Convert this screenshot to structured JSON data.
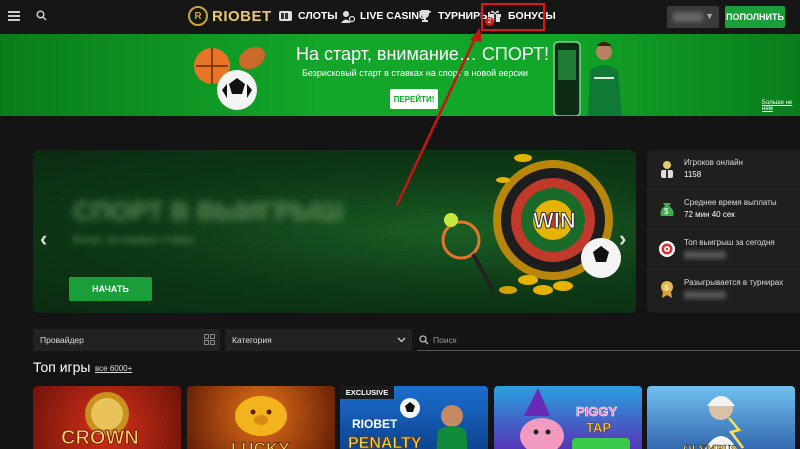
{
  "header": {
    "brand": "RIOBET",
    "nav": [
      {
        "label": "СЛОТЫ",
        "icon": "slots-icon"
      },
      {
        "label": "LIVE CASINO",
        "icon": "live-dealer-icon"
      },
      {
        "label": "ТУРНИРЫ",
        "icon": "trophy-icon"
      },
      {
        "label": "БОНУСЫ",
        "icon": "gift-icon"
      }
    ],
    "bonus_badge": "2",
    "topup_label": "ПОПОЛНИТЬ"
  },
  "promo": {
    "title": "На старт, внимание… СПОРТ!",
    "subtitle": "Безрисковый старт в ставках на спорт в новой версии",
    "button": "ПЕРЕЙТИ!",
    "more_link": "Больше не нем"
  },
  "hero": {
    "title": "СПОРТ В ВЫИГРЫШ",
    "subtitle": "Бонус за первую ставку",
    "button": "НАЧАТЬ",
    "art_label": "WIN"
  },
  "stats": [
    {
      "label": "Игроков онлайн",
      "value": "1158",
      "icon": "player-icon"
    },
    {
      "label": "Среднее время выплаты",
      "value": "72 мин 40 сек",
      "icon": "money-bag-icon"
    },
    {
      "label": "Топ выигрыш за сегодня",
      "value": "",
      "icon": "target-icon"
    },
    {
      "label": "Разыгрывается в турнирах",
      "value": "",
      "icon": "medal-icon"
    }
  ],
  "filters": {
    "provider": "Провайдер",
    "category": "Категория",
    "search_placeholder": "Поиск"
  },
  "section": {
    "title": "Топ игры",
    "link": "все 6000+"
  },
  "games": [
    {
      "name": "CROWN COINS",
      "bg": "#8a1d0c"
    },
    {
      "name": "LUCKY",
      "bg": "#7a1c06"
    },
    {
      "name": "RIOBET PENALTY",
      "bg": "#0d4fa0",
      "badge": "EXCLUSIVE"
    },
    {
      "name": "PIGGY TAP",
      "bg": "#3a1f86"
    },
    {
      "name": "GATES OF OLYMPUS",
      "bg": "#2c6fb0"
    }
  ],
  "colors": {
    "accent_green": "#1a9e3a",
    "highlight_red": "#e01717",
    "gold": "#e9c86b"
  }
}
